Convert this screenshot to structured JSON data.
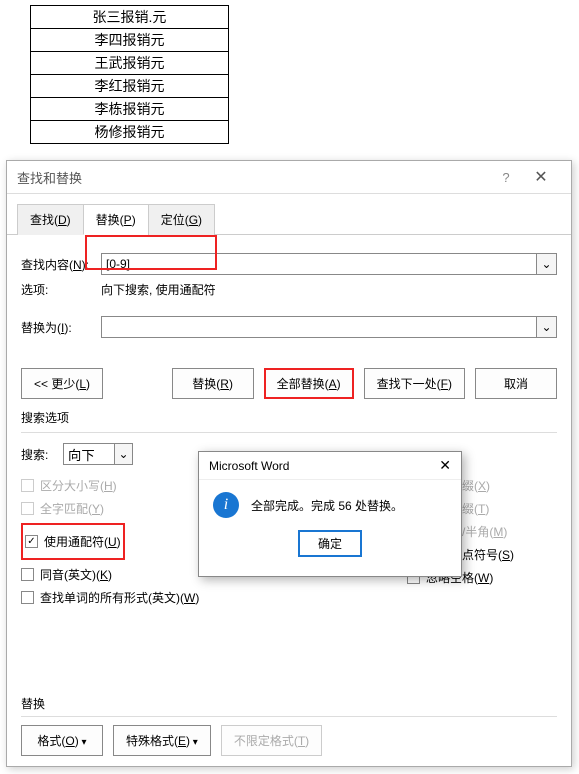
{
  "table_rows": [
    "张三报销.元",
    "李四报销元",
    "王武报销元",
    "李红报销元",
    "李栋报销元",
    "杨修报销元"
  ],
  "dialog": {
    "title": "查找和替换",
    "help": "?",
    "tabs": {
      "find": "查找(D)",
      "replace": "替换(P)",
      "goto": "定位(G)"
    },
    "find_label": "查找内容(N):",
    "find_value": "[0-9]",
    "options_label": "选项:",
    "options_value": "向下搜索, 使用通配符",
    "replace_label": "替换为(I):",
    "replace_value": "",
    "buttons": {
      "less": "<< 更少(L)",
      "replace": "替换(R)",
      "replace_all": "全部替换(A)",
      "find_next": "查找下一处(F)",
      "cancel": "取消"
    },
    "search_options_label": "搜索选项",
    "search_label": "搜索:",
    "search_dir": "向下",
    "checks": {
      "match_case": "区分大小写(H)",
      "whole_word": "全字匹配(Y)",
      "wildcards": "使用通配符(U)",
      "sounds_like": "同音(英文)(K)",
      "all_forms": "查找单词的所有形式(英文)(W)",
      "prefix": "区分前缀(X)",
      "suffix": "区分后缀(T)",
      "fullhalf": "区分全/半角(M)",
      "ignore_punct": "忽略标点符号(S)",
      "ignore_space": "忽略空格(W)"
    },
    "replace_section": "替换",
    "fmt_buttons": {
      "format": "格式(O)",
      "special": "特殊格式(E)",
      "noformat": "不限定格式(T)"
    }
  },
  "msgbox": {
    "title": "Microsoft Word",
    "text": "全部完成。完成 56 处替换。",
    "ok": "确定"
  }
}
